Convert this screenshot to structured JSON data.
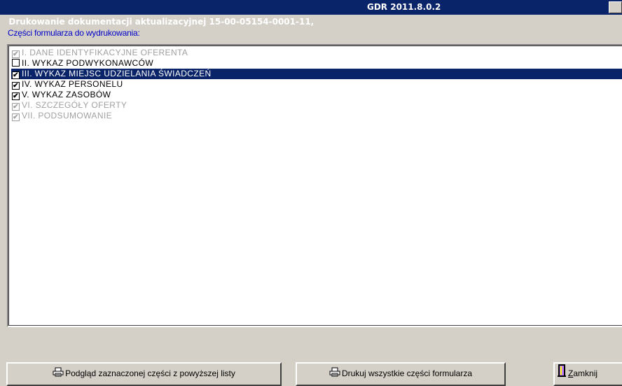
{
  "window": {
    "title": "Drukowanie dokumentacji aktualizacyjnej 15-00-05154-0001-11,",
    "version": "GDR 2011.8.0.2",
    "close_glyph": "×"
  },
  "section_label": "Części formularza do wydrukowania:",
  "list_items": [
    {
      "label": "I. DANE IDENTYFIKACYJNE OFERENTA",
      "checked": true,
      "disabled": true,
      "selected": false
    },
    {
      "label": "II. WYKAZ PODWYKONAWCÓW",
      "checked": false,
      "disabled": false,
      "selected": false
    },
    {
      "label": "III. WYKAZ MIEJSC UDZIELANIA ŚWIADCZEŃ",
      "checked": true,
      "disabled": false,
      "selected": true
    },
    {
      "label": "IV. WYKAZ PERSONELU",
      "checked": true,
      "disabled": false,
      "selected": false
    },
    {
      "label": "V. WYKAZ ZASOBÓW",
      "checked": true,
      "disabled": false,
      "selected": false
    },
    {
      "label": "VI. SZCZEGÓŁY OFERTY",
      "checked": true,
      "disabled": true,
      "selected": false
    },
    {
      "label": "VII. PODSUMOWANIE",
      "checked": true,
      "disabled": true,
      "selected": false
    }
  ],
  "buttons": {
    "preview_label": "Podgląd zaznaczonej części z powyższej listy",
    "print_all_label": "Drukuj wszystkie części formularza",
    "close_label_first": "Z",
    "close_label_rest": "amknij"
  },
  "icons": {
    "preview": "printer-icon",
    "print_all": "printer-icon",
    "close": "door-exit-icon",
    "check": "✔"
  }
}
